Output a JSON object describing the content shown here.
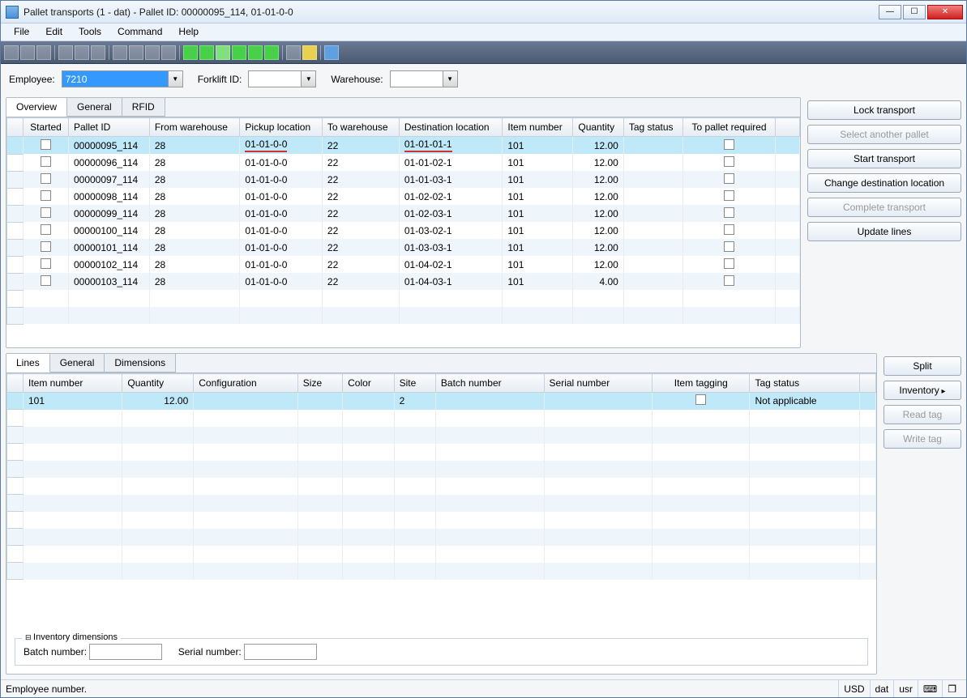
{
  "window": {
    "title": "Pallet transports (1 - dat) - Pallet ID: 00000095_114, 01-01-0-0"
  },
  "menu": {
    "file": "File",
    "edit": "Edit",
    "tools": "Tools",
    "command": "Command",
    "help": "Help"
  },
  "filters": {
    "employee_label": "Employee:",
    "employee_value": "7210",
    "forklift_label": "Forklift ID:",
    "forklift_value": "",
    "warehouse_label": "Warehouse:",
    "warehouse_value": ""
  },
  "upper_tabs": {
    "overview": "Overview",
    "general": "General",
    "rfid": "RFID"
  },
  "upper_cols": {
    "started": "Started",
    "pallet": "Pallet ID",
    "from_wh": "From warehouse",
    "pickup": "Pickup location",
    "to_wh": "To warehouse",
    "dest": "Destination location",
    "item": "Item number",
    "qty": "Quantity",
    "tag": "Tag status",
    "required": "To pallet required"
  },
  "upper_rows": [
    {
      "pallet": "00000095_114",
      "from": "28",
      "pickup": "01-01-0-0",
      "to": "22",
      "dest": "01-01-01-1",
      "item": "101",
      "qty": "12.00",
      "sel": true,
      "hl": true
    },
    {
      "pallet": "00000096_114",
      "from": "28",
      "pickup": "01-01-0-0",
      "to": "22",
      "dest": "01-01-02-1",
      "item": "101",
      "qty": "12.00"
    },
    {
      "pallet": "00000097_114",
      "from": "28",
      "pickup": "01-01-0-0",
      "to": "22",
      "dest": "01-01-03-1",
      "item": "101",
      "qty": "12.00"
    },
    {
      "pallet": "00000098_114",
      "from": "28",
      "pickup": "01-01-0-0",
      "to": "22",
      "dest": "01-02-02-1",
      "item": "101",
      "qty": "12.00"
    },
    {
      "pallet": "00000099_114",
      "from": "28",
      "pickup": "01-01-0-0",
      "to": "22",
      "dest": "01-02-03-1",
      "item": "101",
      "qty": "12.00"
    },
    {
      "pallet": "00000100_114",
      "from": "28",
      "pickup": "01-01-0-0",
      "to": "22",
      "dest": "01-03-02-1",
      "item": "101",
      "qty": "12.00"
    },
    {
      "pallet": "00000101_114",
      "from": "28",
      "pickup": "01-01-0-0",
      "to": "22",
      "dest": "01-03-03-1",
      "item": "101",
      "qty": "12.00"
    },
    {
      "pallet": "00000102_114",
      "from": "28",
      "pickup": "01-01-0-0",
      "to": "22",
      "dest": "01-04-02-1",
      "item": "101",
      "qty": "12.00"
    },
    {
      "pallet": "00000103_114",
      "from": "28",
      "pickup": "01-01-0-0",
      "to": "22",
      "dest": "01-04-03-1",
      "item": "101",
      "qty": "4.00"
    }
  ],
  "right_buttons": {
    "lock": "Lock transport",
    "select": "Select another pallet",
    "start": "Start transport",
    "change": "Change destination location",
    "complete": "Complete transport",
    "update": "Update lines"
  },
  "right_buttons2": {
    "split": "Split",
    "inventory": "Inventory",
    "readtag": "Read tag",
    "writetag": "Write tag"
  },
  "lower_tabs": {
    "lines": "Lines",
    "general": "General",
    "dimensions": "Dimensions"
  },
  "lower_cols": {
    "item": "Item number",
    "qty": "Quantity",
    "config": "Configuration",
    "size": "Size",
    "color": "Color",
    "site": "Site",
    "batch": "Batch number",
    "serial": "Serial number",
    "tagging": "Item tagging",
    "tagstatus": "Tag status"
  },
  "lower_rows": [
    {
      "item": "101",
      "qty": "12.00",
      "config": "",
      "size": "",
      "color": "",
      "site": "2",
      "batch": "",
      "serial": "",
      "tagstatus": "Not applicable",
      "sel": true
    }
  ],
  "inv_dim": {
    "legend": "Inventory dimensions",
    "batch_label": "Batch number:",
    "serial_label": "Serial number:",
    "batch_value": "",
    "serial_value": ""
  },
  "status": {
    "msg": "Employee number.",
    "currency": "USD",
    "company": "dat",
    "user": "usr"
  }
}
